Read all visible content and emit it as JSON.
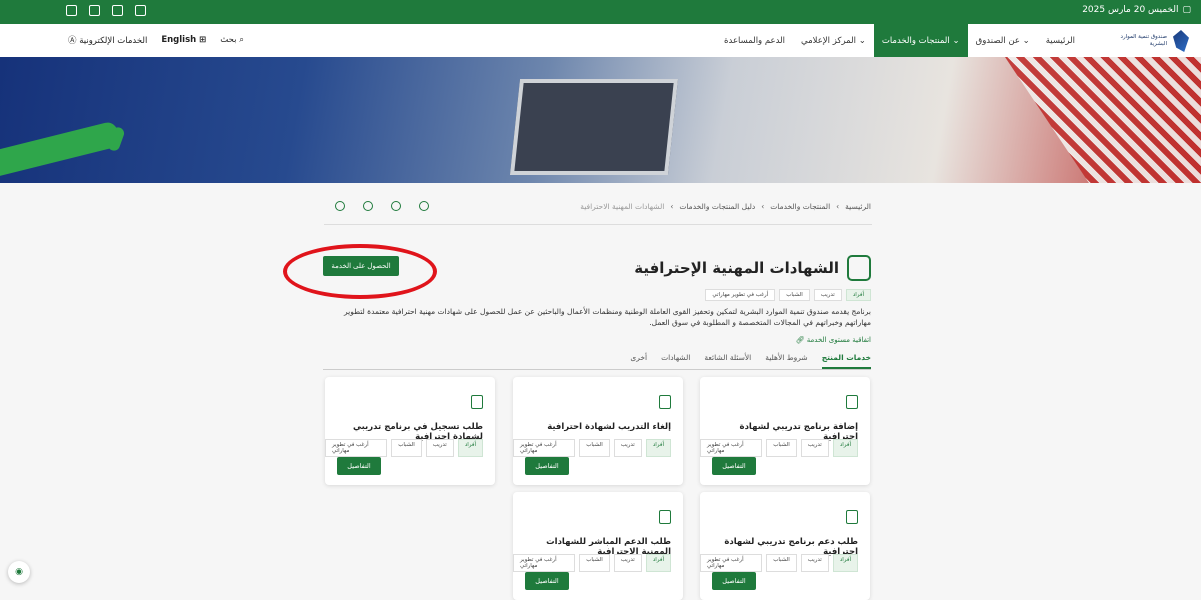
{
  "topbar": {
    "date": "الخميس 20 مارس 2025"
  },
  "nav": {
    "logo_text": "صندوق تنمية الموارد البشرية",
    "menu": [
      "الرئيسية",
      "عن الصندوق",
      "المنتجات والخدمات",
      "المركز الإعلامي",
      "الدعم والمساعدة"
    ],
    "search": "بحث",
    "language": "English",
    "eservices": "الخدمات الإلكترونية"
  },
  "breadcrumb": [
    "الرئيسية",
    "المنتجات والخدمات",
    "دليل المنتجات والخدمات",
    "الشهادات المهنية الاحترافية"
  ],
  "page": {
    "title": "الشهادات المهنية الإحترافية",
    "cta": "الحصول على الخدمة",
    "tags": [
      "أفراد",
      "تدريب",
      "الشباب",
      "أرغب في تطوير مهاراتي"
    ],
    "description": "برنامج يقدمه صندوق تنمية الموارد البشرية لتمكين وتحفيز القوى العاملة الوطنية ومنظمات الأعمال والباحثين عن عمل للحصول على شهادات مهنية احترافية معتمدة لتطوير مهاراتهم وخبراتهم في المجالات المتخصصة و المطلوبة في سوق العمل.",
    "agreement": "اتفاقية مستوى الخدمة"
  },
  "tabs": [
    "خدمات المنتج",
    "شروط الأهلية",
    "الأسئلة الشائعة",
    "الشهادات",
    "أخرى"
  ],
  "cards": [
    {
      "title": "إضافة برنامج تدريبي لشهادة احترافية",
      "details": "التفاصيل"
    },
    {
      "title": "إلغاء التدريب لشهادة احترافية",
      "details": "التفاصيل"
    },
    {
      "title": "طلب تسجيل في برنامج تدريبي لشهادة احترافية",
      "details": "التفاصيل"
    },
    {
      "title": "طلب دعم برنامج تدريبي لشهادة احترافية",
      "details": "التفاصيل"
    },
    {
      "title": "طلب الدعم المباشر للشهادات المهنية الاحترافية",
      "details": "التفاصيل"
    }
  ],
  "colors": {
    "primary": "#1f7a3c",
    "highlight": "#e0141b"
  }
}
